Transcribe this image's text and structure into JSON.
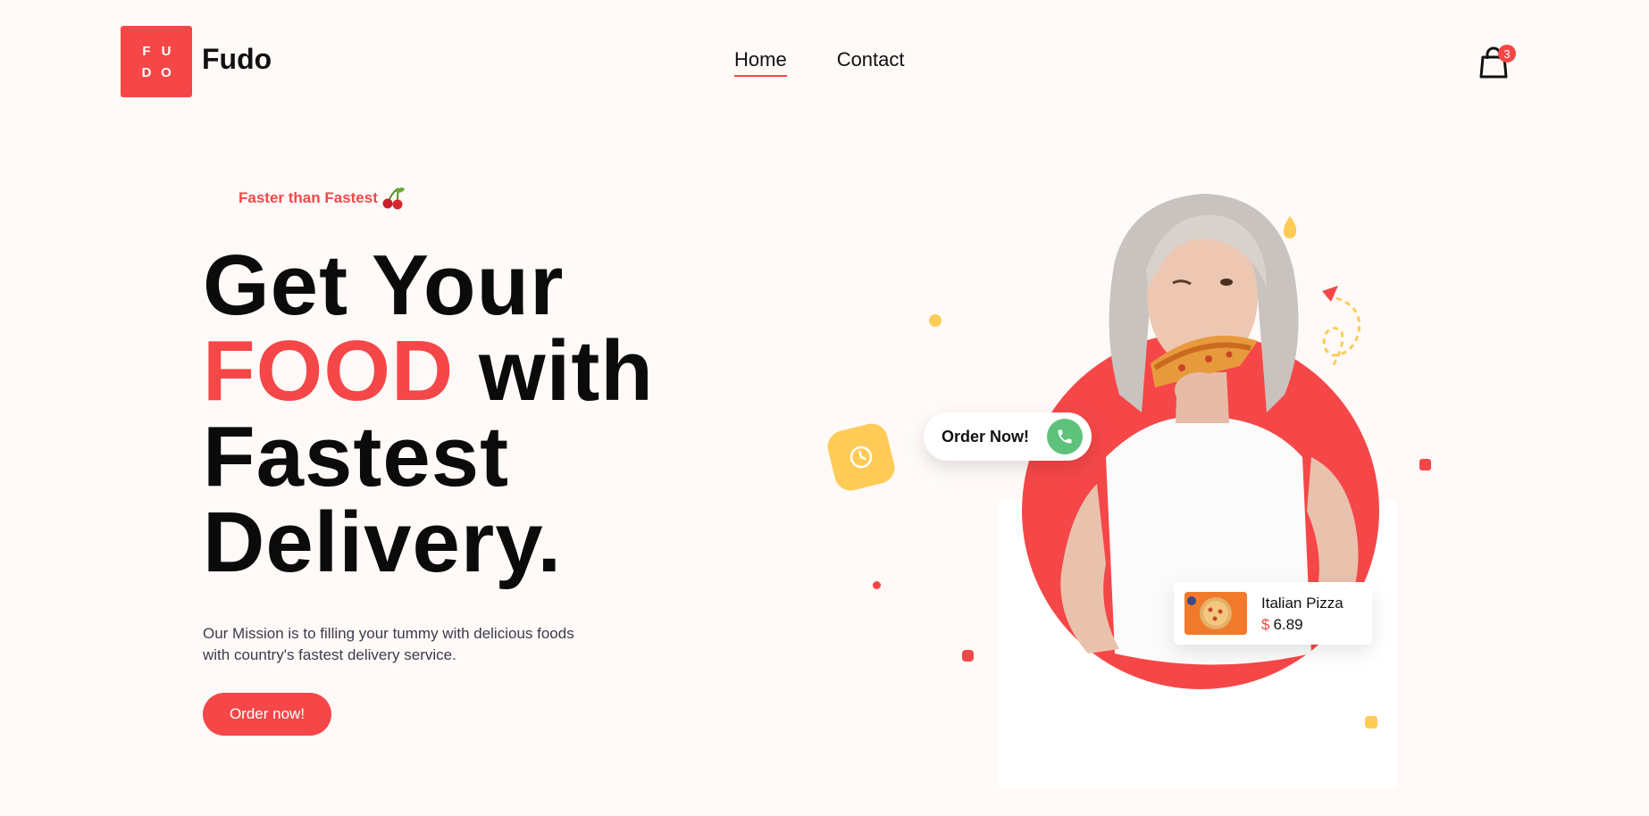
{
  "brand": {
    "logo_letters": [
      "F",
      "U",
      "D",
      "O"
    ],
    "name": "Fudo",
    "accent_color": "#f54748"
  },
  "nav": {
    "items": [
      {
        "label": "Home",
        "active": true
      },
      {
        "label": "Contact",
        "active": false
      }
    ]
  },
  "cart": {
    "icon": "shopping-bag-icon",
    "count": "3"
  },
  "hero": {
    "tagline": "Faster than Fastest",
    "tagline_icon": "cherry-icon",
    "headline": {
      "line1": "Get Your",
      "line2_accent": "FOOD",
      "line2_rest": "with",
      "line3": "Fastest",
      "line4": "Delivery."
    },
    "mission": "Our Mission is to filling your tummy with delicious foods with country's fastest delivery service.",
    "cta_label": "Order now!"
  },
  "widgets": {
    "order_pill": {
      "label": "Order Now!",
      "icon": "phone-icon"
    },
    "clock": {
      "icon": "clock-icon"
    },
    "pizza_card": {
      "name": "Italian Pizza",
      "currency": "$",
      "price": "6.89"
    }
  },
  "colors": {
    "primary": "#f54748",
    "yellow": "#ffcb57",
    "green": "#5fc27a",
    "background": "#fffaf8"
  }
}
